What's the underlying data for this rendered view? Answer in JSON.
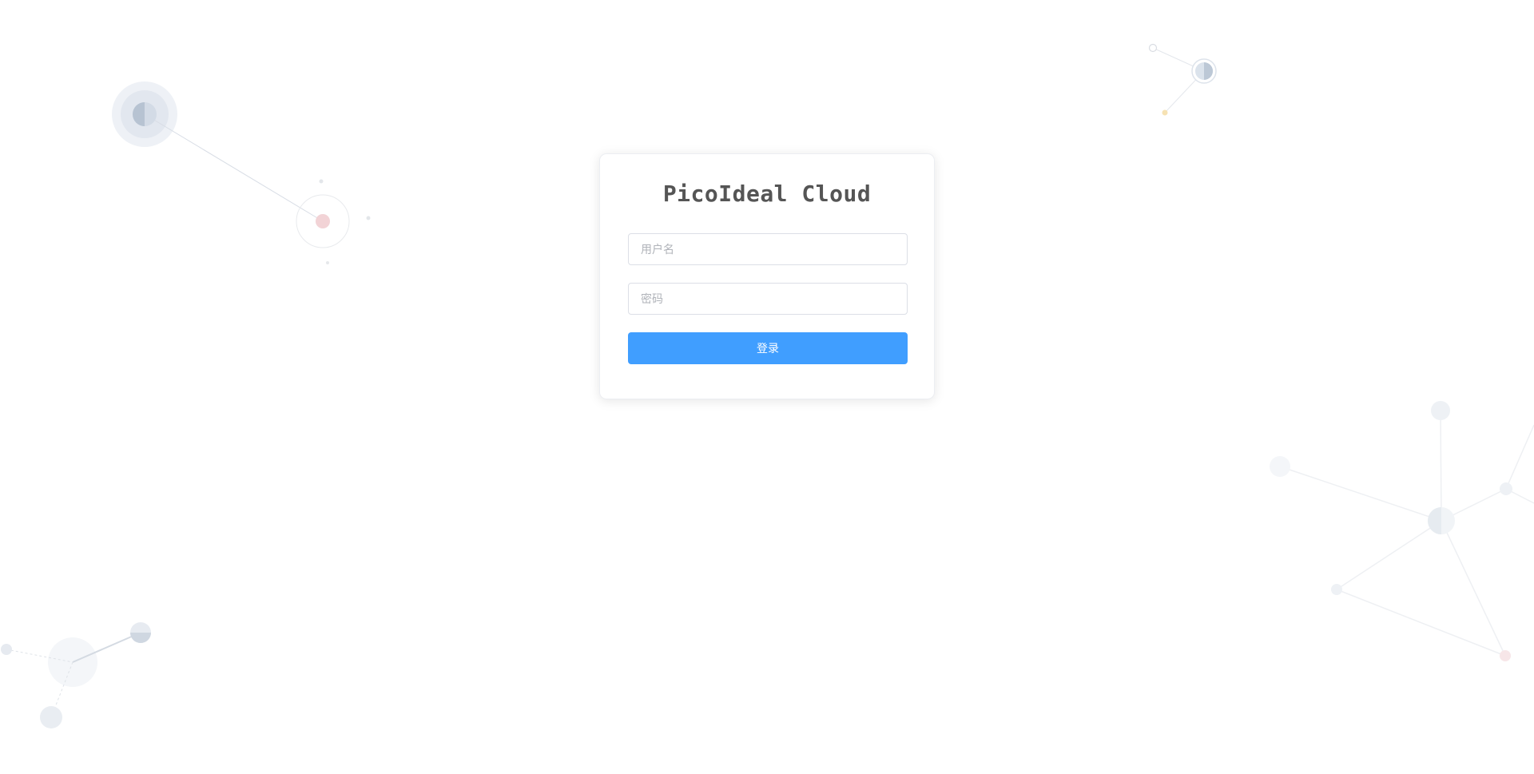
{
  "app": {
    "title": "PicoIdeal Cloud"
  },
  "login_form": {
    "username": {
      "placeholder": "用户名",
      "value": ""
    },
    "password": {
      "placeholder": "密码",
      "value": ""
    },
    "submit_label": "登录"
  },
  "colors": {
    "primary": "#409eff",
    "title": "#555555",
    "input_border": "#dcdfe6",
    "placeholder": "#b0b3b9",
    "background": "#ffffff"
  }
}
